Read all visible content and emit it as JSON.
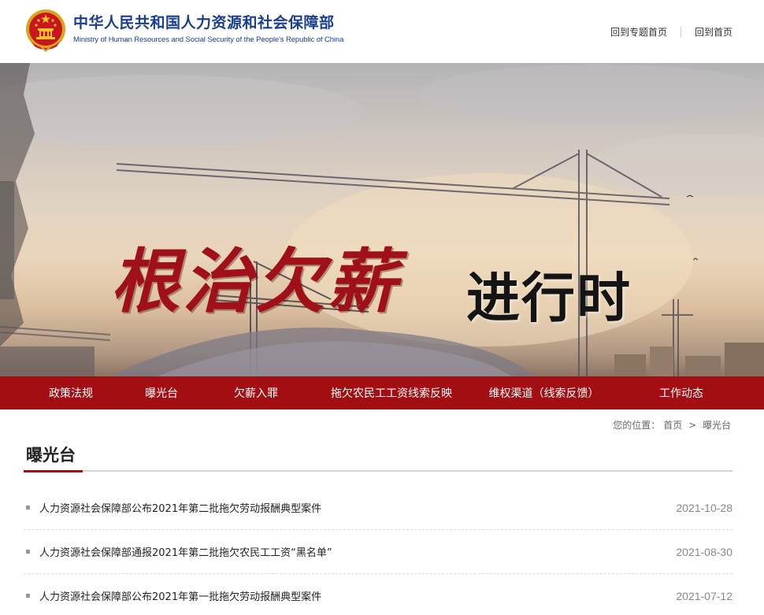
{
  "header": {
    "title_cn": "中华人民共和国人力资源和社会保障部",
    "title_en": "Ministry of Human Resources and Social Security of the People's Republic of China",
    "links": [
      "回到专题首页",
      "回到首页"
    ]
  },
  "banner": {
    "title_red": "根治欠薪",
    "title_black": "进行时"
  },
  "nav": {
    "items": [
      "政策法规",
      "曝光台",
      "欠薪入罪",
      "拖欠农民工工资线索反映",
      "维权渠道（线索反馈）",
      "工作动态"
    ]
  },
  "breadcrumb": {
    "prefix": "您的位置：",
    "home": "首页",
    "sep": ">",
    "current": "曝光台"
  },
  "section": {
    "title": "曝光台"
  },
  "articles": [
    {
      "title": "人力资源社会保障部公布2021年第二批拖欠劳动报酬典型案件",
      "date": "2021-10-28"
    },
    {
      "title": "人力资源社会保障部通报2021年第二批拖欠农民工工资“黑名单”",
      "date": "2021-08-30"
    },
    {
      "title": "人力资源社会保障部公布2021年第一批拖欠劳动报酬典型案件",
      "date": "2021-07-12"
    }
  ],
  "colors": {
    "brand_red": "#a30e13",
    "title_blue": "#1a3f8f"
  }
}
